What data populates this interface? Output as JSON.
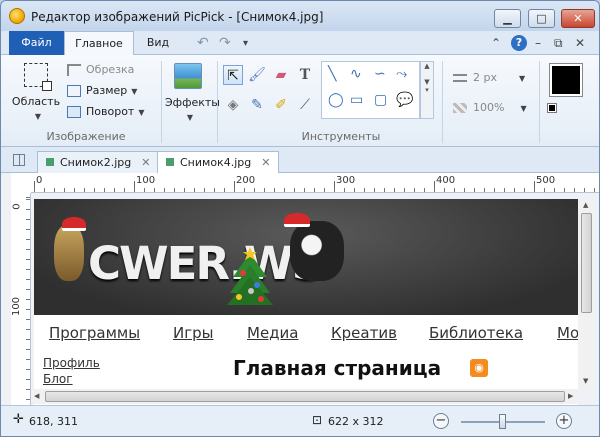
{
  "window": {
    "title": "Редактор изображений PicPick - [Снимок4.jpg]",
    "min_label": "▁",
    "max_label": "□",
    "close_label": "✕"
  },
  "ribbon_tabs": {
    "file": "Файл",
    "home": "Главное",
    "view": "Вид"
  },
  "quick_access": {
    "undo": "↶",
    "redo": "↷",
    "more": "▾",
    "help": "?",
    "ribbon_toggle": "⌃",
    "mini_min": "–",
    "mini_max": "⧉",
    "mini_close": "✕"
  },
  "image_group": {
    "label": "Изображение",
    "area_label": "Область",
    "crop_label": "Обрезка",
    "resize_label": "Размер",
    "rotate_label": "Поворот"
  },
  "effects_group": {
    "label": "Эффекты"
  },
  "tools_group": {
    "label": "Инструменты"
  },
  "line_options": {
    "width": "2 px",
    "opacity": "100%"
  },
  "doc_tabs": [
    {
      "label": "Снимок2.jpg",
      "active": false
    },
    {
      "label": "Снимок4.jpg",
      "active": true
    }
  ],
  "rulers": {
    "horizontal": [
      "0",
      "100",
      "200",
      "300",
      "400",
      "500"
    ],
    "vertical": [
      "0",
      "100"
    ]
  },
  "screenshot_content": {
    "logo_text": "CWER.WS",
    "menu": [
      "Программы",
      "Игры",
      "Медиа",
      "Креатив",
      "Библиотека",
      "Мо"
    ],
    "sidebar": [
      "Профиль",
      "Блог"
    ],
    "heading": "Главная страница"
  },
  "status": {
    "cursor_pos": "618, 311",
    "image_size": "622 x 312",
    "zoom_minus": "−",
    "zoom_plus": "+"
  },
  "colors": {
    "file_tab": "#1f5fb6",
    "ribbon_bg": "#dfe9f5",
    "primary_color": "#000000"
  }
}
